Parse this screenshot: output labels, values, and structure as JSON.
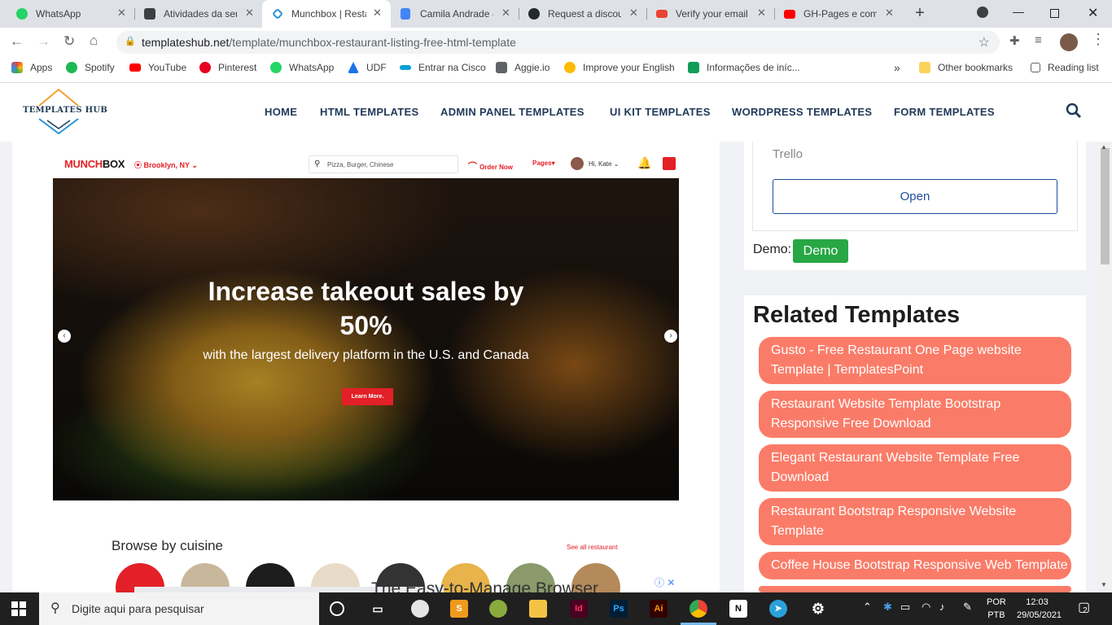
{
  "browser": {
    "tabs": [
      {
        "title": "WhatsApp",
        "color": "#25d366"
      },
      {
        "title": "Atividades da ser",
        "color": "#3c4043"
      },
      {
        "title": "Munchbox | Resta",
        "color": "#2a93d5"
      },
      {
        "title": "Camila Andrade -",
        "color": "#4285f4"
      },
      {
        "title": "Request a discou",
        "color": "#24292e"
      },
      {
        "title": "Verify your email",
        "color": "#ea4335"
      },
      {
        "title": "GH-Pages e como",
        "color": "#ff0000"
      }
    ],
    "new_tab": "+",
    "url_host": "templateshub.net",
    "url_path": "/template/munchbox-restaurant-listing-free-html-template",
    "bookmarks": [
      {
        "label": "Apps",
        "color": "#ea4335"
      },
      {
        "label": "Spotify",
        "color": "#1db954"
      },
      {
        "label": "YouTube",
        "color": "#ff0000"
      },
      {
        "label": "Pinterest",
        "color": "#e60023"
      },
      {
        "label": "WhatsApp",
        "color": "#25d366"
      },
      {
        "label": "UDF",
        "color": "#1a73e8"
      },
      {
        "label": "Entrar na Cisco",
        "color": "#049fd9"
      },
      {
        "label": "Aggie.io",
        "color": "#5f6368"
      },
      {
        "label": "Improve your English",
        "color": "#fbbc04"
      },
      {
        "label": "Informações de iníc...",
        "color": "#0f9d58"
      }
    ],
    "bookmarks_more": "»",
    "other_bookmarks": "Other bookmarks",
    "reading_list": "Reading list"
  },
  "site": {
    "logo_text": "TEMPLATES HUB",
    "nav": [
      "HOME",
      "HTML TEMPLATES",
      "ADMIN PANEL TEMPLATES",
      "UI KIT TEMPLATES",
      "WORDPRESS TEMPLATES",
      "FORM TEMPLATES"
    ]
  },
  "preview": {
    "logo_red": "MUNCH",
    "logo_black": "BOX",
    "location": "Brooklyn, NY",
    "search_placeholder": "Pizza, Burger, Chinese",
    "order_now": "Order Now",
    "pages": "Pages",
    "user": "Hi, Kate",
    "hero_title": "Increase takeout sales by 50%",
    "hero_subtitle": "with the largest delivery platform in the U.S. and Canada",
    "hero_button": "Learn More.",
    "browse_title": "Browse by cuisine",
    "see_all": "See all restaurant",
    "cuisine_colors": [
      "#e32027",
      "#c9b79c",
      "#1d1d1d",
      "#e8dcc8",
      "#333333",
      "#e7b34a",
      "#8a9a6a",
      "#b58a5a"
    ]
  },
  "ad": {
    "text": "The Easy-to-Manage Browser"
  },
  "sidebar": {
    "trello_label": "Trello",
    "open_button": "Open",
    "demo_label": "Demo:",
    "demo_button": "Demo",
    "related_title": "Related Templates",
    "related": [
      "Gusto - Free Restaurant One Page website Template | TemplatesPoint",
      "Restaurant Website Template Bootstrap Responsive Free Download",
      "Elegant Restaurant Website Template Free Download",
      "Restaurant Bootstrap Responsive Website Template",
      "Coffee House Bootstrap Responsive Web Template"
    ]
  },
  "taskbar": {
    "search_placeholder": "Digite aqui para pesquisar",
    "lang_1": "POR",
    "lang_2": "PTB",
    "time": "12:03",
    "date": "29/05/2021",
    "notifications": "2"
  }
}
